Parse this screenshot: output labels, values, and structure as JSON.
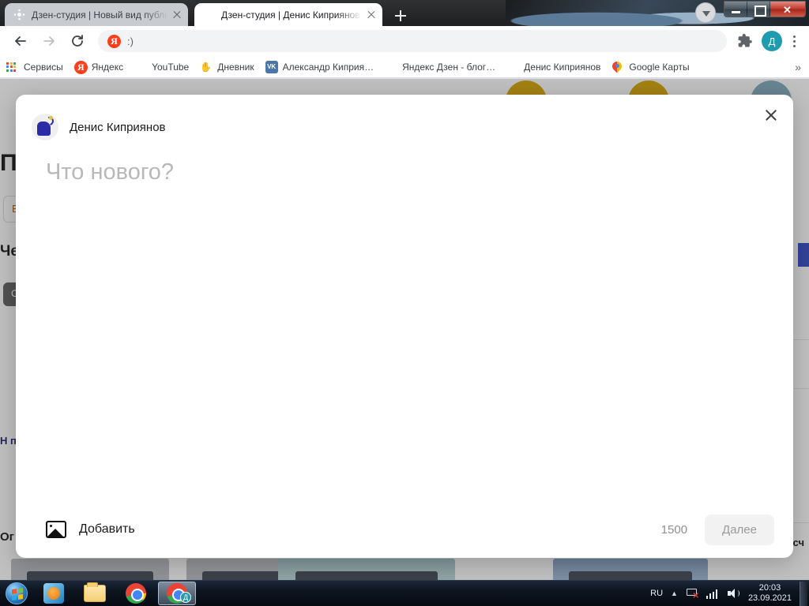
{
  "browser": {
    "tabs": [
      {
        "title": "Дзен-студия | Новый вид публи",
        "favicon": "dzen-icon",
        "active": false
      },
      {
        "title": "Дзен-студия | Денис Киприянов",
        "favicon": "dzen-icon",
        "active": true
      }
    ],
    "new_tab_label": "+",
    "toolbar": {
      "back": "back-arrow",
      "forward": "forward-arrow",
      "reload": "reload",
      "omnibox_icon": "Я",
      "omnibox_value": ":)",
      "extensions": "puzzle-icon",
      "profile_initial": "Д",
      "menu": "kebab-menu"
    },
    "bookmarks": [
      {
        "label": "Сервисы",
        "icon": "apps-grid-icon"
      },
      {
        "label": "Яндекс",
        "icon": "yandex-icon"
      },
      {
        "label": "YouTube",
        "icon": "youtube-icon"
      },
      {
        "label": "Дневник",
        "icon": "hand-icon"
      },
      {
        "label": "Александр Киприя…",
        "icon": "vk-icon"
      },
      {
        "label": "Яндекс Дзен - блог…",
        "icon": "dzen-icon"
      },
      {
        "label": "Денис Киприянов",
        "icon": "dzen-icon"
      },
      {
        "label": "Google Карты",
        "icon": "maps-pin-icon"
      }
    ],
    "bookmarks_overflow": "»",
    "window_controls": {
      "minimize": "—",
      "maximize": "❐",
      "close": "✕",
      "download_orb": "download-arrow"
    }
  },
  "page": {
    "title": "П",
    "box_text": "В",
    "subtitle": "Че",
    "chip": "С",
    "note": "Н\nпу\nпо",
    "footer": "Ог",
    "right_label": "Общий сч"
  },
  "modal": {
    "close_label": "×",
    "author_name": "Денис Киприянов",
    "avatar": "user-avatar",
    "composer_placeholder": "Что нового?",
    "composer_value": "",
    "add_media_label": "Добавить",
    "add_media_icon": "image-icon",
    "char_count": "1500",
    "next_label": "Далее"
  },
  "taskbar": {
    "start": "windows-start-orb",
    "items": [
      {
        "name": "windows-media-player",
        "active": false
      },
      {
        "name": "file-explorer",
        "active": false
      },
      {
        "name": "google-chrome",
        "active": false
      },
      {
        "name": "google-chrome-window",
        "active": true,
        "badge": "Д"
      }
    ],
    "tray": {
      "language": "RU",
      "caret": "▲",
      "network": "network-disconnected-icon",
      "signal": "signal-bars-icon",
      "volume": "volume-icon",
      "time": "20:03",
      "date": "23.09.2021"
    }
  },
  "colors": {
    "chrome_active_tab": "#ffffff",
    "chrome_inactive_tab": "#c8ccd1",
    "yandex_red": "#fc3f1d",
    "profile_teal": "#1f9bb0",
    "next_button_bg": "#f2f2f2",
    "placeholder_grey": "#b8b8b8"
  }
}
